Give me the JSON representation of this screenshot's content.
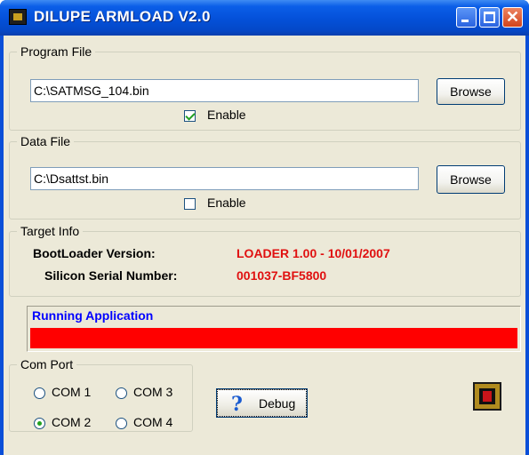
{
  "window": {
    "title": "DILUPE ARMLOAD V2.0"
  },
  "program_file": {
    "legend": "Program File",
    "path": "C:\\SATMSG_104.bin",
    "browse_label": "Browse",
    "enable_label": "Enable",
    "enabled": true
  },
  "data_file": {
    "legend": "Data File",
    "path": "C:\\Dsattst.bin",
    "browse_label": "Browse",
    "enable_label": "Enable",
    "enabled": false
  },
  "target_info": {
    "legend": "Target Info",
    "bootloader_key": "BootLoader Version:",
    "bootloader_value": "LOADER 1.00 - 10/01/2007",
    "serial_key": "Silicon Serial Number:",
    "serial_value": "001037-BF5800"
  },
  "status": {
    "label": "Running Application",
    "progress": 1.0
  },
  "com_port": {
    "legend": "Com Port",
    "options": [
      "COM 1",
      "COM 3",
      "COM 2",
      "COM 4"
    ],
    "selected": "COM 2"
  },
  "debug": {
    "label": "Debug"
  },
  "colors": {
    "titlebar": "#0450d8",
    "info_value": "#e01010",
    "status_label": "#0000ff",
    "progress": "#ff0000"
  }
}
